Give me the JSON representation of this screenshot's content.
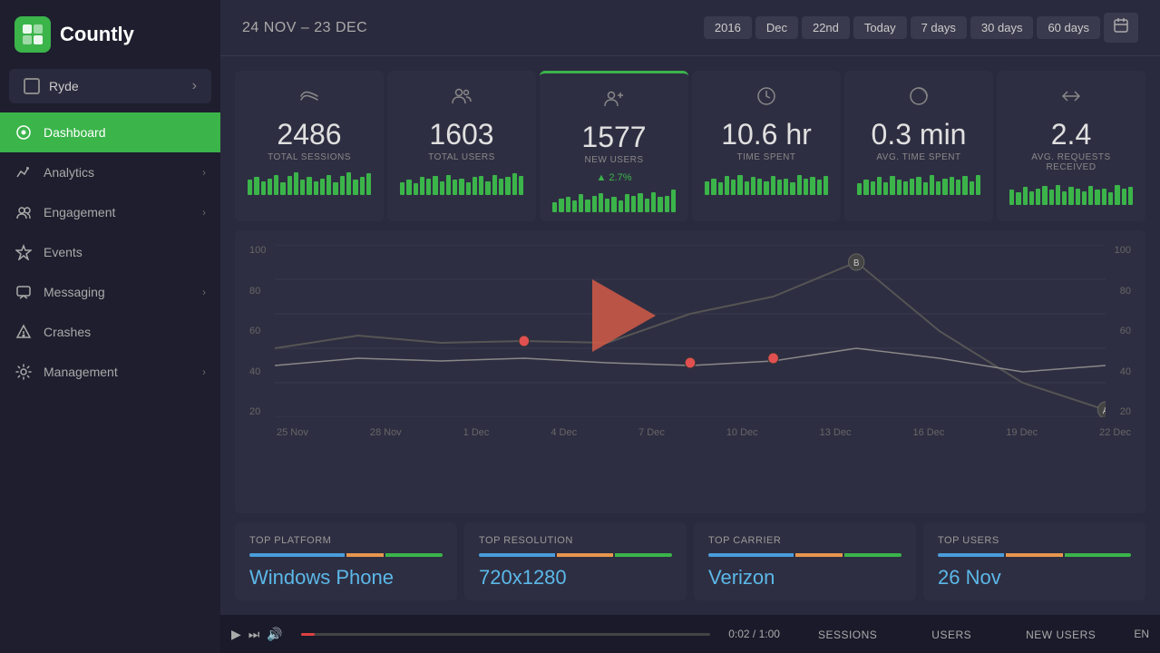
{
  "sidebar": {
    "logo": "Countly",
    "logo_icon": "1|2",
    "app_selector": {
      "name": "Ryde",
      "arrow": "›"
    },
    "nav_items": [
      {
        "id": "dashboard",
        "label": "Dashboard",
        "icon": "⊙",
        "active": true,
        "has_arrow": false
      },
      {
        "id": "analytics",
        "label": "Analytics",
        "icon": "📈",
        "active": false,
        "has_arrow": true
      },
      {
        "id": "engagement",
        "label": "Engagement",
        "icon": "👥",
        "active": false,
        "has_arrow": true
      },
      {
        "id": "events",
        "label": "Events",
        "icon": "⬡",
        "active": false,
        "has_arrow": false
      },
      {
        "id": "messaging",
        "label": "Messaging",
        "icon": "💬",
        "active": false,
        "has_arrow": true
      },
      {
        "id": "crashes",
        "label": "Crashes",
        "icon": "⚠",
        "active": false,
        "has_arrow": false
      },
      {
        "id": "management",
        "label": "Management",
        "icon": "⚙",
        "active": false,
        "has_arrow": true
      }
    ]
  },
  "header": {
    "date_range": "24 NOV – 23 DEC",
    "date_buttons": [
      "2016",
      "Dec",
      "22nd",
      "Today",
      "7 days",
      "30 days",
      "60 days"
    ],
    "cal_icon": "📅"
  },
  "stats": [
    {
      "id": "total-sessions",
      "icon": "〜",
      "value": "2486",
      "label": "TOTAL SESSIONS",
      "trend": null
    },
    {
      "id": "total-users",
      "icon": "👤👤",
      "value": "1603",
      "label": "TOTAL USERS",
      "trend": null
    },
    {
      "id": "new-users",
      "icon": "👤+",
      "value": "1577",
      "label": "NEW USERS",
      "trend": "2.7%",
      "highlight": true
    },
    {
      "id": "time-spent",
      "icon": "🕐",
      "value": "10.6 hr",
      "label": "TIME SPENT",
      "trend": null
    },
    {
      "id": "avg-time-spent",
      "icon": "◑",
      "value": "0.3 min",
      "label": "AVG. TIME SPENT",
      "trend": null
    },
    {
      "id": "avg-requests",
      "icon": "↔",
      "value": "2.4",
      "label": "AVG. REQUESTS RECEIVED",
      "trend": null
    }
  ],
  "chart": {
    "y_labels": [
      "100",
      "80",
      "60",
      "40",
      "20"
    ],
    "y_labels_right": [
      "100",
      "80",
      "60",
      "40",
      "20"
    ],
    "x_labels": [
      "25 Nov",
      "28 Nov",
      "1 Dec",
      "4 Dec",
      "7 Dec",
      "10 Dec",
      "13 Dec",
      "16 Dec",
      "19 Dec",
      "22 Dec"
    ]
  },
  "mini_bar_heights": {
    "total_sessions": [
      60,
      70,
      55,
      65,
      80,
      50,
      75,
      90,
      60,
      70,
      55,
      65,
      80,
      50,
      75,
      90,
      60,
      70,
      85
    ],
    "total_users": [
      50,
      60,
      45,
      70,
      65,
      75,
      55,
      80,
      60,
      65,
      50,
      70,
      75,
      55,
      80,
      65,
      70,
      85,
      75
    ],
    "new_users": [
      40,
      55,
      60,
      45,
      70,
      50,
      65,
      75,
      55,
      60,
      45,
      70,
      65,
      75,
      55,
      80,
      60,
      65,
      90
    ],
    "time_spent": [
      55,
      65,
      50,
      75,
      60,
      80,
      55,
      70,
      65,
      55,
      75,
      60,
      65,
      50,
      80,
      65,
      70,
      60,
      75
    ],
    "avg_time": [
      45,
      60,
      55,
      70,
      50,
      75,
      60,
      55,
      65,
      70,
      50,
      80,
      55,
      65,
      70,
      60,
      75,
      55,
      80
    ],
    "avg_req": [
      60,
      50,
      70,
      55,
      65,
      75,
      60,
      80,
      55,
      70,
      65,
      55,
      75,
      60,
      65,
      50,
      80,
      65,
      70
    ]
  },
  "bottom_cards": [
    {
      "id": "top-platform",
      "title": "TOP PLATFORM",
      "value": "Windows Phone",
      "color_bars": [
        {
          "class": "cb-blue",
          "width": "50%"
        },
        {
          "class": "cb-orange",
          "width": "20%"
        },
        {
          "class": "cb-green",
          "width": "30%"
        }
      ]
    },
    {
      "id": "top-resolution",
      "title": "TOP RESOLUTION",
      "value": "720x1280",
      "color_bars": [
        {
          "class": "cb-blue",
          "width": "40%"
        },
        {
          "class": "cb-orange",
          "width": "30%"
        },
        {
          "class": "cb-green",
          "width": "30%"
        }
      ]
    },
    {
      "id": "top-carrier",
      "title": "TOP CARRIER",
      "value": "Verizon",
      "color_bars": [
        {
          "class": "cb-blue",
          "width": "45%"
        },
        {
          "class": "cb-orange",
          "width": "25%"
        },
        {
          "class": "cb-green",
          "width": "30%"
        }
      ]
    },
    {
      "id": "top-users",
      "title": "TOP USERS",
      "value": "26 Nov",
      "color_bars": [
        {
          "class": "cb-blue",
          "width": "35%"
        },
        {
          "class": "cb-orange",
          "width": "30%"
        },
        {
          "class": "cb-green",
          "width": "35%"
        }
      ]
    }
  ],
  "video_bar": {
    "play_icon": "▶",
    "skip_icon": "⏭",
    "volume_icon": "🔊",
    "time": "0:02 / 1:00",
    "progress_pct": 3.3,
    "lang": "EN"
  },
  "bottom_tabs": [
    "SESSIONS",
    "USERS",
    "NEW USERS"
  ]
}
